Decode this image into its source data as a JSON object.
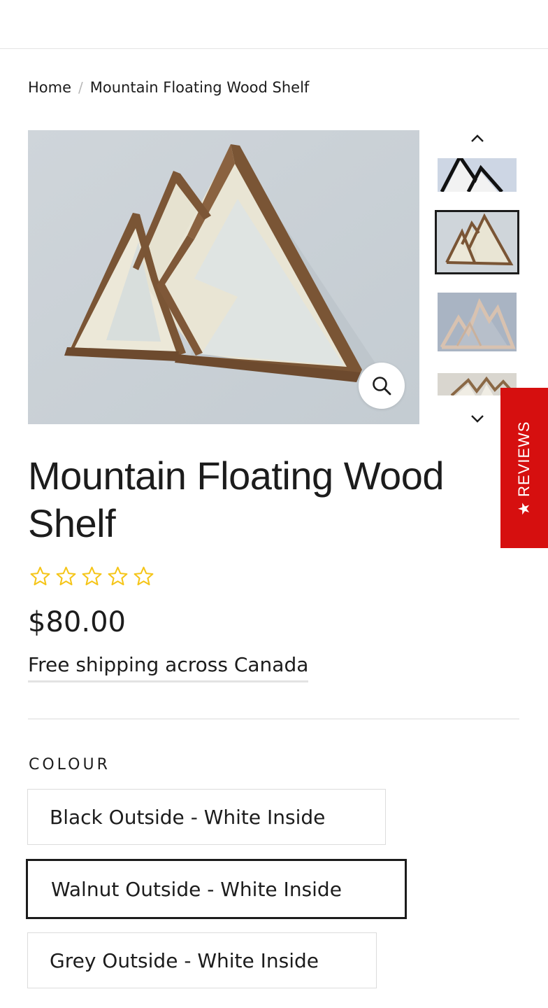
{
  "breadcrumb": {
    "home": "Home",
    "separator": "/",
    "current": "Mountain Floating Wood Shelf"
  },
  "gallery": {
    "main_image": "mountain-shelf-walnut-photo",
    "zoom_icon": "search-icon",
    "thumb_up_icon": "chevron-up-icon",
    "thumb_down_icon": "chevron-down-icon",
    "selected_thumbnail": 2
  },
  "reviews_tab": {
    "label": "REVIEWS",
    "star": "★",
    "color": "#d60f0f"
  },
  "product": {
    "title": "Mountain Floating Wood Shelf",
    "rating": 0,
    "rating_max": 5,
    "star_color": "#f5c518",
    "price": "$80.00",
    "shipping": "Free shipping across Canada"
  },
  "options": {
    "label": "COLOUR",
    "selected": "Walnut Outside - White Inside",
    "values": [
      "Black Outside - White Inside",
      "Walnut Outside - White Inside",
      "Grey Outside - White Inside"
    ]
  }
}
